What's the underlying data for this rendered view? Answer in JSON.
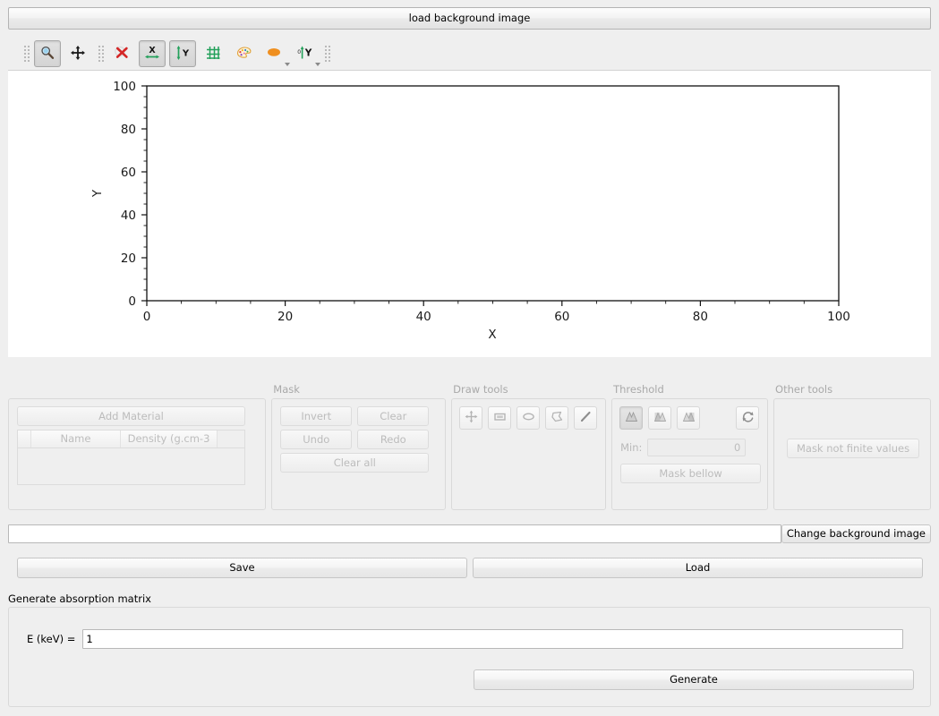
{
  "top": {
    "load_background_label": "load background image"
  },
  "mpl_toolbar": {
    "items": [
      {
        "name": "zoom-icon",
        "title": "Zoom to rectangle",
        "checked": true
      },
      {
        "name": "pan-icon",
        "title": "Pan axes",
        "checked": false
      },
      {
        "name": "delete-red-x-icon",
        "title": "Remove",
        "checked": false
      },
      {
        "name": "lock-x-axis-icon",
        "title": "Lock X axis",
        "checked": true
      },
      {
        "name": "lock-y-axis-icon",
        "title": "Lock Y axis",
        "checked": true
      },
      {
        "name": "grid-icon",
        "title": "Toggle grid",
        "checked": false
      },
      {
        "name": "color-palette-icon",
        "title": "Colormap",
        "checked": false
      },
      {
        "name": "ellipse-marker-icon",
        "title": "Marker style",
        "checked": false
      },
      {
        "name": "y-axis-scale-icon",
        "title": "Y axis scale",
        "checked": false
      }
    ]
  },
  "chart_data": {
    "type": "line",
    "title": "",
    "xlabel": "X",
    "ylabel": "Y",
    "xlim": [
      0,
      100
    ],
    "ylim": [
      0,
      100
    ],
    "xticks": [
      0,
      20,
      40,
      60,
      80,
      100
    ],
    "yticks": [
      0,
      20,
      40,
      60,
      80,
      100
    ],
    "xminor_step": 5,
    "yminor_step": 5,
    "grid": false,
    "legend": null,
    "series": [],
    "background_color": "#ffffff",
    "axes_color": "#000000"
  },
  "materials": {
    "add_material_label": "Add Material",
    "columns": [
      "Name",
      "Density (g.cm-3"
    ],
    "rows": []
  },
  "mask": {
    "title": "Mask",
    "invert_label": "Invert",
    "clear_label": "Clear",
    "undo_label": "Undo",
    "redo_label": "Redo",
    "clear_all_label": "Clear all"
  },
  "draw_tools": {
    "title": "Draw tools",
    "tools": [
      {
        "name": "move-tool-icon",
        "label": "Move",
        "pressed": false
      },
      {
        "name": "rectangle-tool-icon",
        "label": "Rectangle",
        "pressed": false
      },
      {
        "name": "ellipse-tool-icon",
        "label": "Ellipse",
        "pressed": false
      },
      {
        "name": "polygon-tool-icon",
        "label": "Polygon",
        "pressed": false
      },
      {
        "name": "pencil-tool-icon",
        "label": "Pencil",
        "pressed": false
      }
    ]
  },
  "threshold": {
    "title": "Threshold",
    "modes": [
      {
        "name": "histogram-mode-1-icon",
        "pressed": true
      },
      {
        "name": "histogram-mode-2-icon",
        "pressed": false
      },
      {
        "name": "histogram-mode-3-icon",
        "pressed": false
      }
    ],
    "reset_icon": "refresh-icon",
    "min_label": "Min:",
    "min_value": "0",
    "mask_bellow_label": "Mask bellow"
  },
  "other_tools": {
    "title": "Other tools",
    "mask_not_finite_label": "Mask not finite values"
  },
  "path_row": {
    "path_value": "",
    "path_placeholder": "",
    "change_background_label": "Change background image"
  },
  "save_load": {
    "save_label": "Save",
    "load_label": "Load"
  },
  "generate": {
    "section_title": "Generate absorption matrix",
    "energy_label": "E (keV) =",
    "energy_value": "1",
    "generate_label": "Generate"
  },
  "colors": {
    "window_bg": "#efefef",
    "plot_bg": "#ffffff",
    "accent_green": "#23a05a",
    "accent_red": "#d02020",
    "accent_orange": "#eb8f1e",
    "disabled_text": "#bcbcbc"
  }
}
